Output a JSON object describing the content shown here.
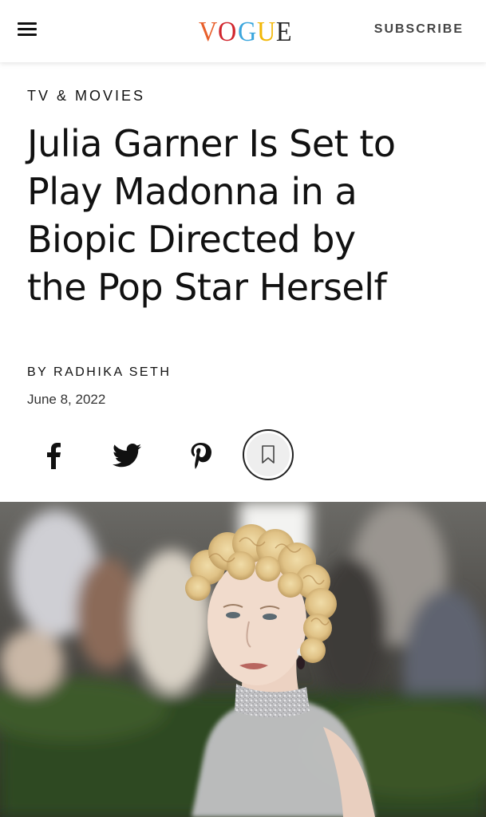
{
  "header": {
    "logo_letters": [
      "V",
      "O",
      "G",
      "U",
      "E"
    ],
    "logo_colors": [
      "#e8602c",
      "#d1262d",
      "#3aa6dd",
      "#f2b705",
      "#222222"
    ],
    "subscribe_label": "SUBSCRIBE",
    "menu_icon": "hamburger-menu-icon"
  },
  "article": {
    "section": "TV & MOVIES",
    "headline_lines": [
      "Julia Garner Is Set to",
      "Play Madonna in a",
      "Biopic Directed by",
      "the Pop Star Herself"
    ],
    "byline_prefix": "BY",
    "author": "RADHIKA SETH",
    "date": "June 8, 2022"
  },
  "share": {
    "icons": [
      "facebook-icon",
      "twitter-icon",
      "pinterest-icon",
      "bookmark-icon"
    ]
  },
  "hero_image": {
    "subject": "curly-blonde-hair-portrait",
    "colors": {
      "hair": "#e3c68c",
      "skin": "#efd7c8",
      "dress": "#bdbdbf",
      "background_green": "#2f4a22"
    }
  }
}
